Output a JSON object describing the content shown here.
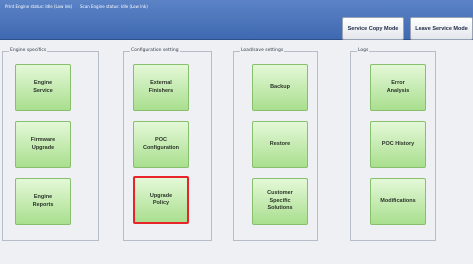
{
  "header": {
    "status_left": "Print Engine status: Idle (Low Ink)",
    "status_right": "Scan Engine status: Idle (Low Ink)",
    "service_copy_mode": "Service Copy Mode",
    "leave_service_mode": "Leave Service Mode"
  },
  "groups": {
    "engine_specifics": {
      "label": "Engine specifics",
      "tiles": [
        "Engine\nService",
        "Firmware\nUpgrade",
        "Engine\nReports"
      ]
    },
    "configuration_setting": {
      "label": "Configuration setting",
      "tiles": [
        "External\nFinishers",
        "POC\nConfiguration",
        "Upgrade\nPolicy"
      ]
    },
    "load_save_settings": {
      "label": "Load/save settings",
      "tiles": [
        "Backup",
        "Restore",
        "Customer\nSpecific\nSolutions"
      ]
    },
    "logs": {
      "label": "Logs",
      "tiles": [
        "Error\nAnalysis",
        "POC History",
        "Modifications"
      ]
    }
  },
  "colors": {
    "header": "#4a72b8",
    "tile": "#b6e4a0",
    "selected_outline": "#e8242a"
  }
}
